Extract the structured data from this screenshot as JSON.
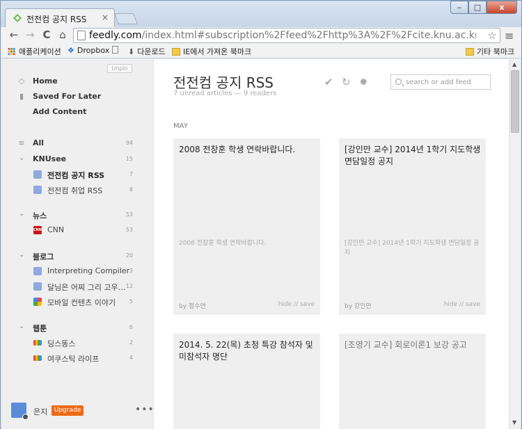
{
  "browser": {
    "tab_title": "전전컴 공지 RSS",
    "tab_close": "×",
    "url_host": "feedly.com",
    "url_path": "/index.html#subscription%2Ffeed%2Fhttp%3A%2F%2Fcite.knu.ac.kr%2Fee_new%2F",
    "back_icon": "←",
    "forward_icon": "→",
    "reload_icon": "C",
    "home_icon": "⌂",
    "star_icon": "☆",
    "menu_icon": "≡",
    "min_icon": "‒",
    "max_icon": "□",
    "close_icon": "x"
  },
  "bookmarks": {
    "apps": "애플리케이션",
    "dropbox": "Dropbox",
    "download": "다운로드",
    "ie_import": "IE에서 가져온 북마크",
    "other": "기타 북마크"
  },
  "sidebar": {
    "unpin": "Unpin",
    "home": "Home",
    "saved": "Saved For Later",
    "add": "Add Content",
    "all": "All",
    "all_count": "94",
    "categories": [
      {
        "name": "KNUsee",
        "count": "15",
        "feeds": [
          {
            "name": "전전컴 공지 RSS",
            "count": "7"
          },
          {
            "name": "전전컴 취업 RSS",
            "count": "8"
          }
        ]
      },
      {
        "name": "뉴스",
        "count": "53",
        "feeds": [
          {
            "name": "CNN",
            "count": "53"
          }
        ]
      },
      {
        "name": "블로그",
        "count": "20",
        "feeds": [
          {
            "name": "Interpreting Compiler",
            "count": "3"
          },
          {
            "name": "달님은 어찌 그리 고우…",
            "count": "12"
          },
          {
            "name": "모바일 컨텐츠 이야기",
            "count": "5"
          }
        ]
      },
      {
        "name": "웹툰",
        "count": "6",
        "feeds": [
          {
            "name": "딩스똥스",
            "count": "2"
          },
          {
            "name": "여쿠스틱 라이프",
            "count": "4"
          }
        ]
      }
    ],
    "cnn_badge": "CNN",
    "user_name": "은지",
    "upgrade": "Upgrade",
    "more": "•••"
  },
  "main": {
    "title": "전전컴 공지 RSS",
    "subtitle": "7 unread articles — 9 readers",
    "check_icon": "✔",
    "refresh_icon": "↻",
    "settings_icon": "✹",
    "search_placeholder": "search or add feed",
    "month": "MAY",
    "cards": [
      {
        "title": "2008 전창훈 학생 연락바랍니다.",
        "snippet": "2008 전창훈 학생 연락바랍니다.",
        "by": "by 정수연",
        "actions": "hide  //  save"
      },
      {
        "title": "[강인만 교수] 2014년 1학기 지도학생 면담일정 공지",
        "snippet": "[강인만 교수] 2014년 1학기 지도학생 면담일정 공지",
        "by": "by 강인만",
        "actions": "hide  //  save"
      },
      {
        "title": "2014. 5. 22(목) 초청 특강 참석자 및 미참석자 명단"
      },
      {
        "title": "[조영기 교수] 회로이론1 보강 공고"
      }
    ]
  },
  "colors": {
    "accent_orange": "#ee6a14",
    "sidebar_bg": "#efefef",
    "card_bg": "#efefef"
  }
}
